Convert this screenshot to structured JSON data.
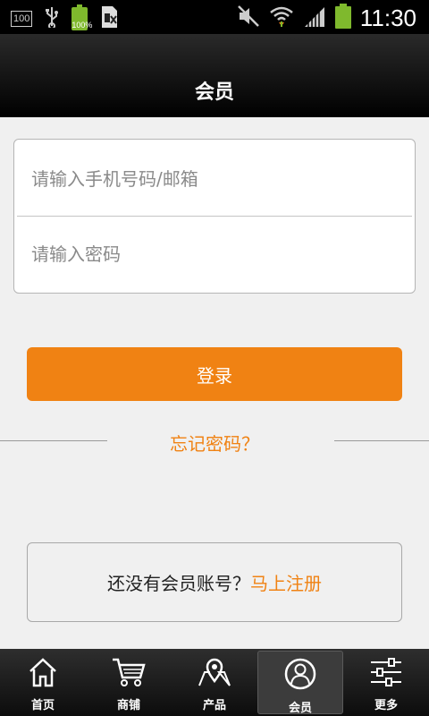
{
  "status_bar": {
    "notification_badge": "100",
    "battery_small_label": "100%",
    "time": "11:30"
  },
  "header": {
    "title": "会员"
  },
  "login_form": {
    "phone_placeholder": "请输入手机号码/邮箱",
    "phone_value": "",
    "password_placeholder": "请输入密码",
    "password_value": "",
    "login_button": "登录",
    "forgot_password": "忘记密码？"
  },
  "register": {
    "question": "还没有会员账号？",
    "link": "马上注册"
  },
  "bottom_nav": {
    "active": "会员",
    "items": [
      {
        "label": "首页",
        "icon": "home-icon"
      },
      {
        "label": "商铺",
        "icon": "cart-icon"
      },
      {
        "label": "产品",
        "icon": "map-pin-icon"
      },
      {
        "label": "会员",
        "icon": "user-icon"
      },
      {
        "label": "更多",
        "icon": "sliders-icon"
      }
    ]
  },
  "colors": {
    "accent": "#f08213",
    "header_bg": "#000000",
    "page_bg": "#f0f0f0"
  }
}
